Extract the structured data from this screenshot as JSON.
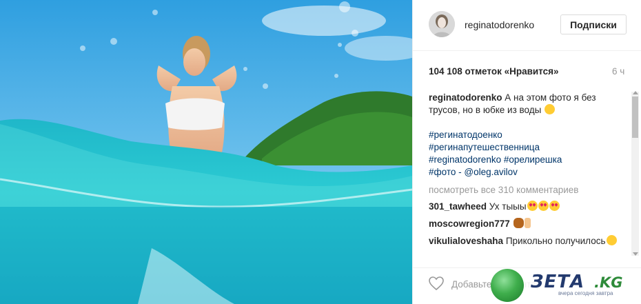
{
  "post": {
    "username": "reginatodorenko",
    "follow_button": "Подписки",
    "likes": "104 108 отметок «Нравится»",
    "time_ago": "6 ч"
  },
  "caption": {
    "user": "reginatodorenko",
    "text": " А на этом фото я без трусов, но в юбке из воды ",
    "emoji": "laughing-with-tears-icon",
    "tags": {
      "line1": "#регинатодоенко",
      "line2": "#регинапутешественница",
      "line3a": "#reginatodorenko",
      "line3b": "#орелирешка",
      "line4_tag": "#фото",
      "line4_sep": " - ",
      "line4_mention": "@oleg.avilov"
    }
  },
  "view_all_comments": "посмотреть все 310 комментариев",
  "comments": [
    {
      "user": "301_tawheed",
      "text": " Ух тыыы",
      "emoji": [
        "heart-eyes-icon",
        "heart-eyes-icon",
        "heart-eyes-icon"
      ]
    },
    {
      "user": "moscowregion777",
      "text": " ",
      "emoji": [
        "see-no-evil-monkey-icon",
        "index-finger-up-icon"
      ]
    },
    {
      "user": "vikulialoveshaha",
      "text": " Прикольно получилось",
      "emoji": [
        "grimacing-face-icon"
      ]
    }
  ],
  "add_comment": {
    "placeholder": "Добавьте комментарий..."
  },
  "watermark": {
    "brand": "ЗЕТА",
    "suffix": ".KG",
    "tagline": "вчера сегодня завтра"
  },
  "colors": {
    "hashtag": "#003569",
    "muted": "#999999",
    "text": "#262626",
    "border": "#efefef"
  }
}
